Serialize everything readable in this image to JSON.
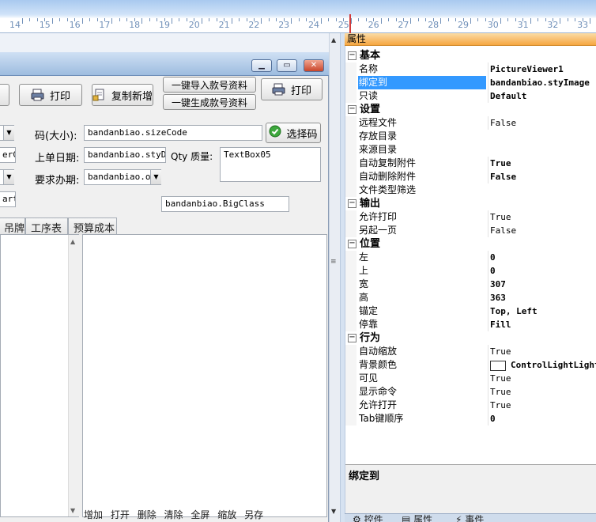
{
  "ruler": {
    "labels": [
      "14",
      "15",
      "16",
      "17",
      "18",
      "19",
      "20",
      "21",
      "22",
      "23",
      "24",
      "25",
      "26",
      "27",
      "28",
      "29",
      "30",
      "31",
      "32",
      "33"
    ]
  },
  "form": {
    "buttons": {
      "print_left": "打印",
      "copy_new": "复制新增",
      "import_style": "一键导入款号资料",
      "generate_style": "一键生成款号资料",
      "print_right": "打印",
      "select_code": "选择码"
    },
    "fields": {
      "size_label": "码(大小):",
      "size_value": "bandanbiao.sizeCode",
      "order_date_label": "上单日期:",
      "order_date_value": "bandanbiao.styDa",
      "qty_label": "Qty 质量:",
      "qty_value": "TextBox05",
      "require_date_label": "要求办期:",
      "require_date_value": "bandanbiao.ou",
      "bigclass_value": "bandanbiao.BigClass",
      "left_partial_1": "erCr",
      "left_partial_2": "art"
    },
    "tabs": [
      "吊牌",
      "工序表",
      "预算成本"
    ],
    "picviewer_menu": [
      "增加",
      "打开",
      "删除",
      "清除",
      "全屏",
      "缩放",
      "另存"
    ]
  },
  "properties": {
    "header": "属性",
    "categories": [
      {
        "title": "基本",
        "rows": [
          {
            "name": "名称",
            "value": "PictureViewer1",
            "bold": true
          },
          {
            "name": "绑定到",
            "value": "bandanbiao.styImage",
            "bold": true,
            "selected": true
          },
          {
            "name": "只读",
            "value": "Default",
            "bold": true
          }
        ]
      },
      {
        "title": "设置",
        "rows": [
          {
            "name": "远程文件",
            "value": "False",
            "bold": false
          },
          {
            "name": "存放目录",
            "value": "",
            "bold": false
          },
          {
            "name": "来源目录",
            "value": "",
            "bold": false
          },
          {
            "name": "自动复制附件",
            "value": "True",
            "bold": true
          },
          {
            "name": "自动删除附件",
            "value": "False",
            "bold": true
          },
          {
            "name": "文件类型筛选",
            "value": "",
            "bold": false
          }
        ]
      },
      {
        "title": "输出",
        "rows": [
          {
            "name": "允许打印",
            "value": "True",
            "bold": false
          },
          {
            "name": "另起一页",
            "value": "False",
            "bold": false
          }
        ]
      },
      {
        "title": "位置",
        "rows": [
          {
            "name": "左",
            "value": "0",
            "bold": true
          },
          {
            "name": "上",
            "value": "0",
            "bold": true
          },
          {
            "name": "宽",
            "value": "307",
            "bold": true
          },
          {
            "name": "高",
            "value": "363",
            "bold": true
          },
          {
            "name": "锚定",
            "value": "Top, Left",
            "bold": true
          },
          {
            "name": "停靠",
            "value": "Fill",
            "bold": true
          }
        ]
      },
      {
        "title": "行为",
        "rows": [
          {
            "name": "自动缩放",
            "value": "True",
            "bold": false
          },
          {
            "name": "背景颜色",
            "value": "ControlLightLight",
            "bold": true,
            "swatch": true
          },
          {
            "name": "可见",
            "value": "True",
            "bold": false
          },
          {
            "name": "显示命令",
            "value": "True",
            "bold": false
          },
          {
            "name": "允许打开",
            "value": "True",
            "bold": false
          },
          {
            "name": "Tab键顺序",
            "value": "0",
            "bold": true
          }
        ]
      }
    ],
    "description_title": "绑定到",
    "bottom_tabs": [
      "控件",
      "属性",
      "事件"
    ]
  },
  "colors": {
    "selection": "#3399ff",
    "header_orange": "#f6a640",
    "ruler_marker": "#d23a3a"
  }
}
